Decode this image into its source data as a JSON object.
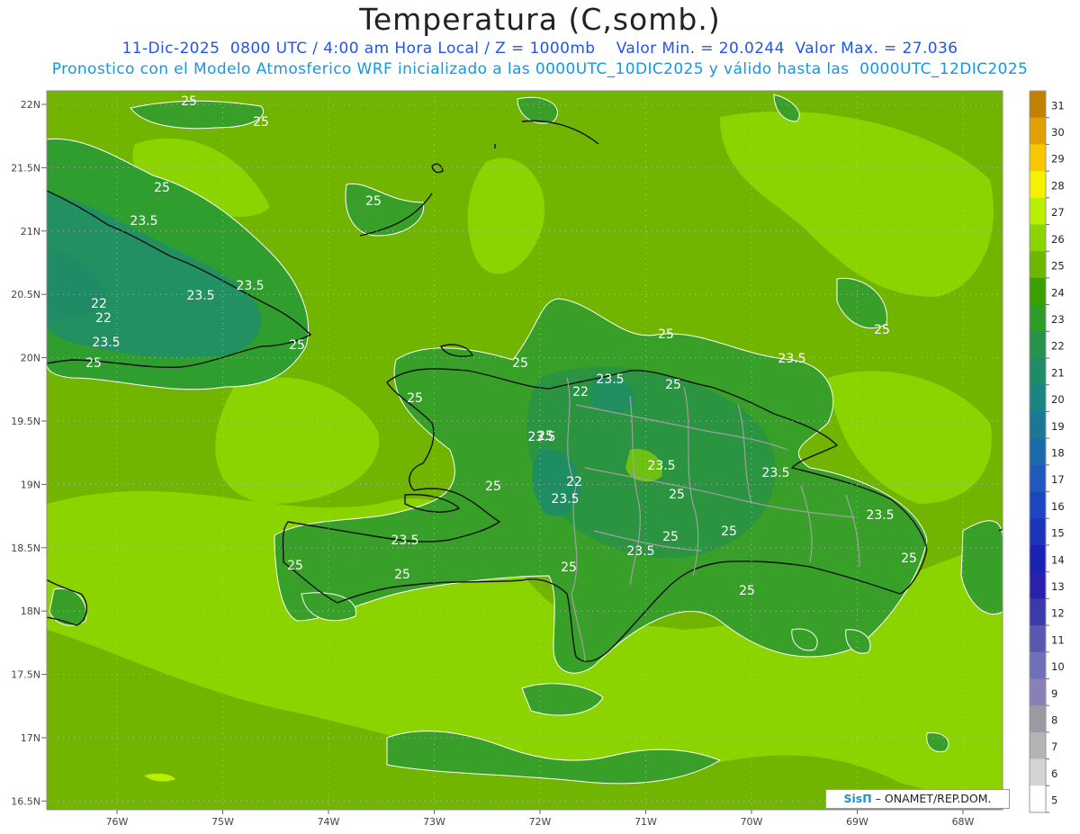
{
  "header": {
    "title": "Temperatura (C,somb.)",
    "line1": "11-Dic-2025  0800 UTC / 4:00 am Hora Local / Z = 1000mb    Valor Min. = 20.0244  Valor Max. = 27.036",
    "line2": "Pronostico con el Modelo Atmosferico WRF inicializado a las 0000UTC_10DIC2025 y válido hasta las  0000UTC_12DIC2025"
  },
  "map": {
    "lat_labels": [
      "22N",
      "21.5N",
      "21N",
      "20.5N",
      "20N",
      "19.5N",
      "19N",
      "18.5N",
      "18N",
      "17.5N",
      "17N",
      "16.5N"
    ],
    "lon_labels": [
      "76W",
      "75W",
      "74W",
      "73W",
      "72W",
      "71W",
      "70W",
      "69W",
      "68W"
    ],
    "contour_labels": [
      "25",
      "25",
      "25",
      "25",
      "23.5",
      "23.5",
      "23.5",
      "22",
      "22",
      "23.5",
      "25",
      "25",
      "25",
      "25",
      "25",
      "23.5",
      "22",
      "23.5",
      "25",
      "23.5",
      "22",
      "23.5",
      "25",
      "23.5",
      "25",
      "23.5",
      "25",
      "25",
      "23.5",
      "25",
      "23.5",
      "25",
      "25",
      "25",
      "25",
      "25",
      "23.5",
      "25"
    ]
  },
  "colorbar": {
    "labels": [
      "31",
      "30",
      "29",
      "28",
      "27",
      "26",
      "25",
      "24",
      "23",
      "22",
      "21",
      "20",
      "19",
      "18",
      "17",
      "16",
      "15",
      "14",
      "13",
      "12",
      "11",
      "10",
      "9",
      "8",
      "7",
      "6",
      "5"
    ],
    "colors": [
      "#c08000",
      "#e0a000",
      "#f7c800",
      "#f7f000",
      "#b8f000",
      "#8cd400",
      "#6cb800",
      "#3aa000",
      "#2d9c28",
      "#25944a",
      "#1e8c66",
      "#1a8480",
      "#1a7896",
      "#1c6aac",
      "#2058bc",
      "#1c46c0",
      "#1a34bc",
      "#1a22b4",
      "#2a20ac",
      "#3a3aa8",
      "#5858b0",
      "#7070b8",
      "#8a80b8",
      "#9a9aa2",
      "#b4b4b4",
      "#d4d4d4",
      "#ffffff"
    ]
  },
  "credit": {
    "brand": "SisΠ",
    "text": "– ONAMET/REP.DOM."
  }
}
